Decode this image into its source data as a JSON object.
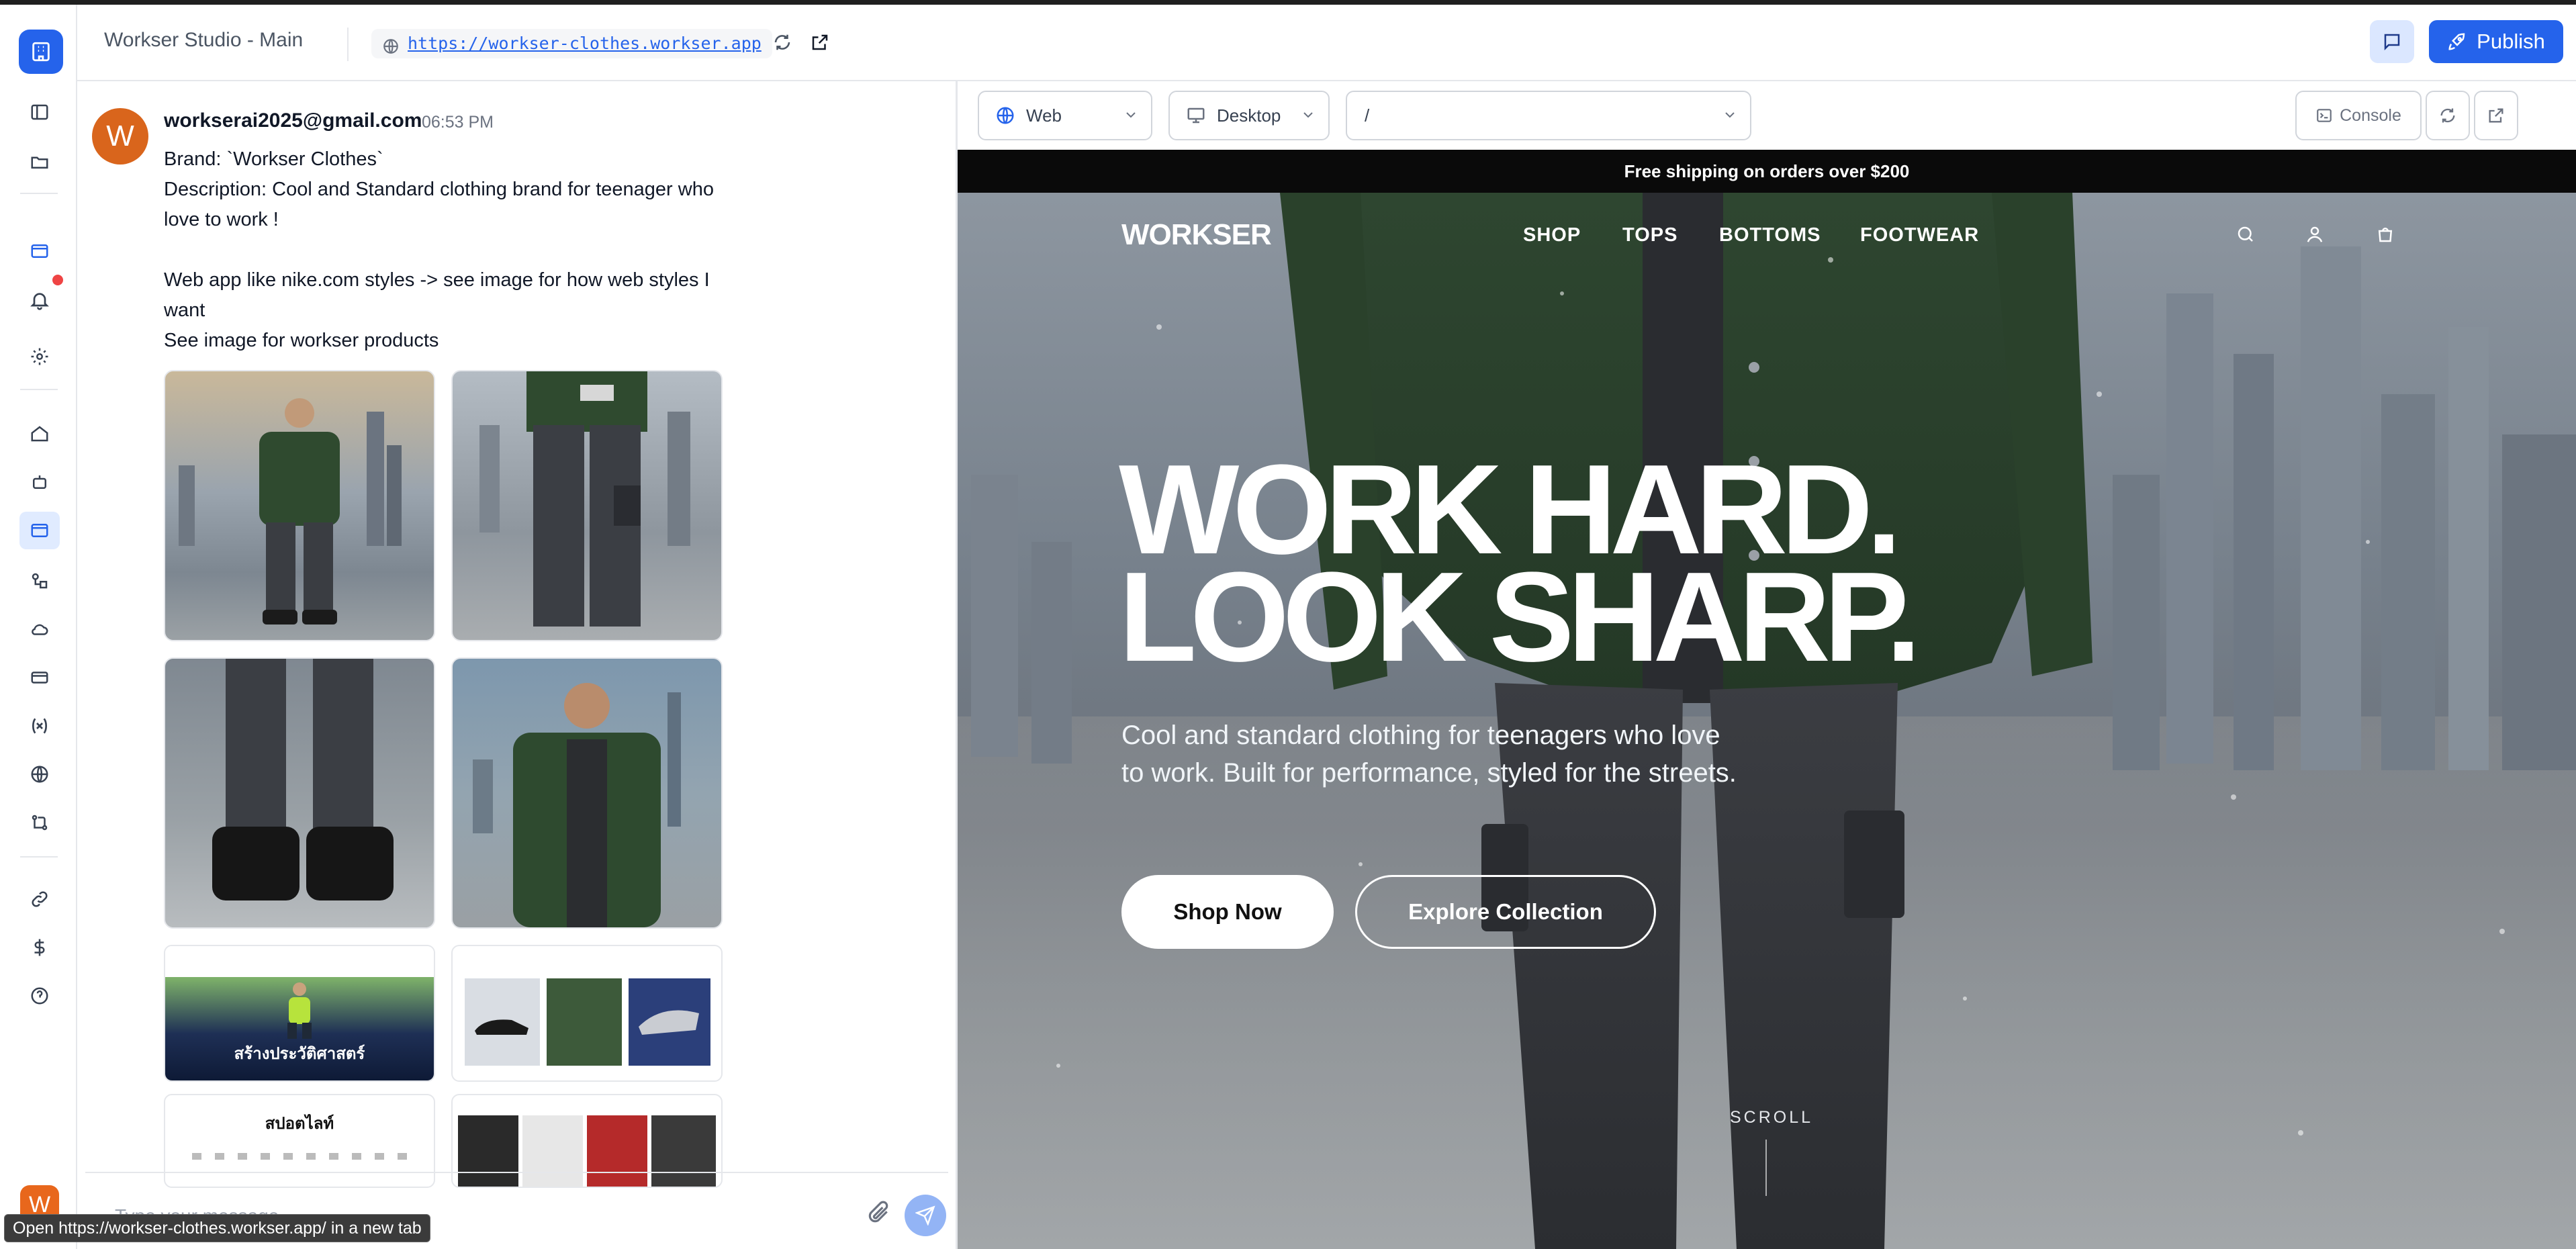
{
  "header": {
    "title": "Workser Studio - Main",
    "url": "https://workser-clothes.workser.app",
    "publish_label": "Publish"
  },
  "rail": {
    "avatar_letter": "W"
  },
  "chat": {
    "avatar_letter": "W",
    "sender": "workserai2025@gmail.com",
    "time": "06:53 PM",
    "lines": [
      "Brand: `Workser Clothes`",
      "Description: Cool and Standard clothing brand for teenager who love to work !",
      "",
      "Web app like nike.com styles -> see image for how web styles I want",
      "See image for workser products"
    ],
    "thumb_texts": {
      "site1_banner": "สร้างประวัติศาสตร์",
      "site3_title": "สปอตไลท์"
    },
    "composer_placeholder": "Type your message..."
  },
  "tooltip": {
    "text": "Open https://workser-clothes.workser.app/ in a new tab"
  },
  "preview_toolbar": {
    "platform": "Web",
    "device": "Desktop",
    "route": "/",
    "console_label": "Console"
  },
  "site": {
    "announcement": "Free shipping on orders over $200",
    "brand": "WORKSER",
    "nav": [
      "SHOP",
      "TOPS",
      "BOTTOMS",
      "FOOTWEAR"
    ],
    "headline_1": "WORK HARD.",
    "headline_2": "LOOK SHARP.",
    "subtext": "Cool and standard clothing for teenagers who love to work. Built for performance, styled for the streets.",
    "cta_primary": "Shop Now",
    "cta_secondary": "Explore Collection",
    "scroll_label": "SCROLL"
  },
  "colors": {
    "accent": "#2563eb",
    "avatar": "#d9651c",
    "notification": "#ef4444"
  }
}
